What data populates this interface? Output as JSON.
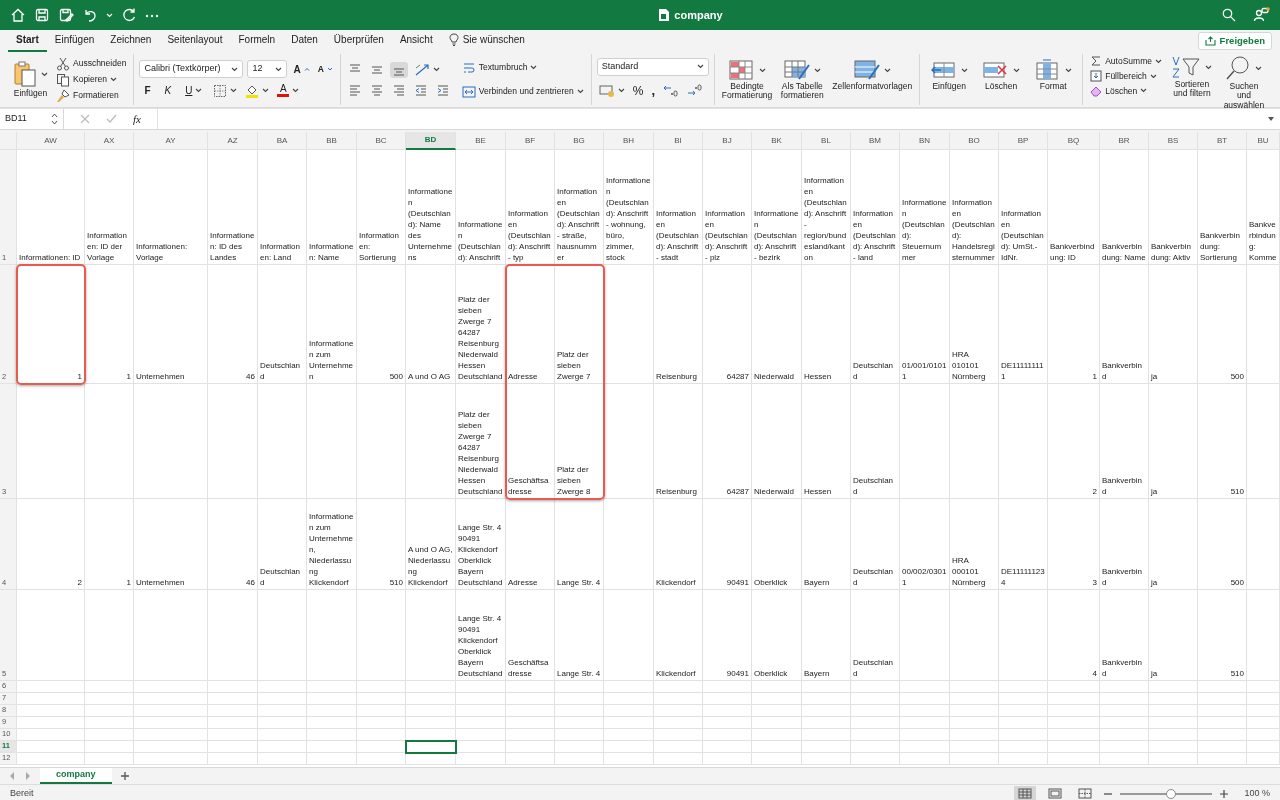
{
  "title_bar": {
    "title": "company"
  },
  "menu_tabs": [
    {
      "label": "Start",
      "selected": true
    },
    {
      "label": "Einfügen",
      "selected": false
    },
    {
      "label": "Zeichnen",
      "selected": false
    },
    {
      "label": "Seitenlayout",
      "selected": false
    },
    {
      "label": "Formeln",
      "selected": false
    },
    {
      "label": "Daten",
      "selected": false
    },
    {
      "label": "Überprüfen",
      "selected": false
    },
    {
      "label": "Ansicht",
      "selected": false
    }
  ],
  "tell_me": "Sie wünschen",
  "share_button": "Freigeben",
  "ribbon": {
    "clipboard": {
      "paste": "Einfügen",
      "items": [
        {
          "kind": "cut",
          "label": "Ausschneiden",
          "dropdown": false
        },
        {
          "kind": "copy",
          "label": "Kopieren",
          "dropdown": true
        },
        {
          "kind": "brush",
          "label": "Formatieren",
          "dropdown": false
        }
      ]
    },
    "font": {
      "name": "Calibri (Textkörper)",
      "size": "12",
      "grow": "A",
      "shrink": "A",
      "styles": [
        {
          "kind": "bold",
          "label": "F"
        },
        {
          "kind": "italic",
          "label": "K"
        },
        {
          "kind": "underline",
          "label": "U"
        }
      ],
      "font_color": "A"
    },
    "alignment": {
      "vertical": [
        {
          "kind": "top",
          "selected": false
        },
        {
          "kind": "middle",
          "selected": false
        },
        {
          "kind": "bottom",
          "selected": true
        }
      ],
      "wrap": "Textumbruch",
      "merge": "Verbinden und zentrieren"
    },
    "number": {
      "format": "Standard",
      "percent": "%",
      "comma": ","
    },
    "styles": [
      {
        "kind": "conditional",
        "label": "Bedingte Formatierung"
      },
      {
        "kind": "table",
        "label": "Als Tabelle formatieren"
      },
      {
        "kind": "cellstyle",
        "label": "Zellenformatvorlagen"
      }
    ],
    "cells": [
      {
        "kind": "insert",
        "label": "Einfügen"
      },
      {
        "kind": "delete",
        "label": "Löschen"
      },
      {
        "kind": "format",
        "label": "Format"
      }
    ],
    "editing": {
      "items": [
        {
          "kind": "sum",
          "label": "AutoSumme"
        },
        {
          "kind": "fill",
          "label": "Füllbereich"
        },
        {
          "kind": "clear",
          "label": "Löschen"
        }
      ],
      "large": [
        {
          "kind": "sort",
          "label": "Sortieren und filtern"
        },
        {
          "kind": "find",
          "label": "Suchen und auswählen"
        }
      ]
    }
  },
  "formula_bar": {
    "name_box": "BD11",
    "function_label": "fx"
  },
  "sheet": {
    "columns": [
      {
        "letter": "AW",
        "kind": "number",
        "selected": false
      },
      {
        "letter": "AX",
        "kind": "number",
        "selected": false
      },
      {
        "letter": "AY",
        "kind": "text",
        "selected": false
      },
      {
        "letter": "AZ",
        "kind": "number",
        "selected": false
      },
      {
        "letter": "BA",
        "kind": "text",
        "selected": false
      },
      {
        "letter": "BB",
        "kind": "text",
        "selected": false
      },
      {
        "letter": "BC",
        "kind": "number",
        "selected": false
      },
      {
        "letter": "BD",
        "kind": "text",
        "selected": true
      },
      {
        "letter": "BE",
        "kind": "text",
        "selected": false
      },
      {
        "letter": "BF",
        "kind": "text",
        "selected": false
      },
      {
        "letter": "BG",
        "kind": "text",
        "selected": false
      },
      {
        "letter": "BH",
        "kind": "text",
        "selected": false
      },
      {
        "letter": "BI",
        "kind": "text",
        "selected": false
      },
      {
        "letter": "BJ",
        "kind": "number",
        "selected": false
      },
      {
        "letter": "BK",
        "kind": "text",
        "selected": false
      },
      {
        "letter": "BL",
        "kind": "text",
        "selected": false
      },
      {
        "letter": "BM",
        "kind": "text",
        "selected": false
      },
      {
        "letter": "BN",
        "kind": "text",
        "selected": false
      },
      {
        "letter": "BO",
        "kind": "text",
        "selected": false
      },
      {
        "letter": "BP",
        "kind": "text",
        "selected": false
      },
      {
        "letter": "BQ",
        "kind": "number",
        "selected": false
      },
      {
        "letter": "BR",
        "kind": "text",
        "selected": false
      },
      {
        "letter": "BS",
        "kind": "text",
        "selected": false
      },
      {
        "letter": "BT",
        "kind": "number",
        "selected": false
      },
      {
        "letter": "BU",
        "kind": "text",
        "selected": false
      }
    ],
    "rows": [
      {
        "number": "1",
        "kind": "header",
        "selected": false,
        "cells": [
          "Informationen: ID",
          "Informationen: ID der Vorlage",
          "Informationen: Vorlage",
          "Informationen: ID des Landes",
          "Informationen: Land",
          "Informationen: Name",
          "Informationen: Sortierung",
          "Informationen (Deutschland): Name des Unternehmens",
          "Informationen (Deutschland): Anschrift",
          "Informationen (Deutschland): Anschrift - typ",
          "Informationen (Deutschland): Anschrift - straße, hausnummer",
          "Informationen (Deutschland): Anschrift - wohnung, büro, zimmer, stock",
          "Informationen (Deutschland): Anschrift - stadt",
          "Informationen (Deutschland): Anschrift - plz",
          "Informationen (Deutschland): Anschrift - bezirk",
          "Informationen (Deutschland): Anschrift - region/bundesland/kanton",
          "Informationen (Deutschland): Anschrift - land",
          "Informationen (Deutschland): Steuernummer",
          "Informationen (Deutschland): Handelsregisternummer",
          "Informationen (Deutschland): UmSt.-IdNr.",
          "Bankverbindung: ID",
          "Bankverbindung: Name",
          "Bankverbindung: Aktiv",
          "Bankverbindung: Sortierung",
          "Bankverbindung: Komme"
        ]
      },
      {
        "number": "2",
        "kind": "data",
        "selected": false,
        "cells": [
          {
            "text": "1",
            "highlight": true
          },
          "1",
          "Unternehmen",
          "46",
          "Deutschland",
          "Informationen zum Unternehmen",
          "500",
          "A und O AG",
          "Platz der sieben Zwerge 7 64287 Reisenburg Niederwald Hessen Deutschland",
          {
            "text": "Adresse",
            "highlight": true
          },
          {
            "text": "Platz der sieben Zwerge 7",
            "highlight": true
          },
          null,
          "Reisenburg",
          "64287",
          "Niederwald",
          "Hessen",
          "Deutschland",
          "01/001/01011",
          "HRA 010101 Nürnberg",
          "DE111111111",
          "1",
          "Bankverbind",
          "ja",
          "500",
          null
        ]
      },
      {
        "number": "3",
        "kind": "data",
        "selected": false,
        "cells": [
          null,
          null,
          null,
          null,
          null,
          null,
          null,
          null,
          "Platz der sieben Zwerge 7 64287 Reisenburg Niederwald Hessen Deutschland",
          {
            "text": "Geschäftsadresse",
            "highlight": true
          },
          {
            "text": "Platz der sieben Zwerge 8",
            "highlight": true
          },
          null,
          "Reisenburg",
          "64287",
          "Niederwald",
          "Hessen",
          "Deutschland",
          null,
          null,
          null,
          "2",
          "Bankverbind",
          "ja",
          "510",
          null
        ]
      },
      {
        "number": "4",
        "kind": "data",
        "selected": false,
        "cells": [
          "2",
          "1",
          "Unternehmen",
          "46",
          "Deutschland",
          "Informationen zum Unternehmen, Niederlassung Klickendorf",
          "510",
          "A und O AG, Niederlassung Klickendorf",
          "Lange Str. 4 90491 Klickendorf Oberklick Bayern Deutschland",
          "Adresse",
          "Lange Str. 4",
          null,
          "Klickendorf",
          "90491",
          "Oberklick",
          "Bayern",
          "Deutschland",
          "00/002/03011",
          "HRA 000101 Nürnberg",
          "DE111111234",
          "3",
          "Bankverbind",
          "ja",
          "500",
          null
        ]
      },
      {
        "number": "5",
        "kind": "data",
        "selected": false,
        "cells": [
          null,
          null,
          null,
          null,
          null,
          null,
          null,
          null,
          "Lange Str. 4 90491 Klickendorf Oberklick Bayern Deutschland",
          "Geschäftsadresse",
          "Lange Str. 4",
          null,
          "Klickendorf",
          "90491",
          "Oberklick",
          "Bayern",
          "Deutschland",
          null,
          null,
          null,
          "4",
          "Bankverbind",
          "ja",
          "510",
          null
        ]
      },
      {
        "number": "6",
        "kind": "data",
        "selected": false,
        "cells": []
      },
      {
        "number": "7",
        "kind": "data",
        "selected": false,
        "cells": []
      },
      {
        "number": "8",
        "kind": "data",
        "selected": false,
        "cells": []
      },
      {
        "number": "9",
        "kind": "data",
        "selected": false,
        "cells": []
      },
      {
        "number": "10",
        "kind": "data",
        "selected": false,
        "cells": []
      },
      {
        "number": "11",
        "kind": "data",
        "selected": true,
        "cells": []
      },
      {
        "number": "12",
        "kind": "data",
        "selected": false,
        "cells": []
      }
    ]
  },
  "sheet_tabs": [
    {
      "label": "company",
      "selected": true
    }
  ],
  "status_bar": {
    "status": "Bereit",
    "views": [
      {
        "kind": "normal",
        "selected": true
      },
      {
        "kind": "layout",
        "selected": false
      },
      {
        "kind": "pagebreak",
        "selected": false
      }
    ],
    "zoom": {
      "level": 0.55,
      "label": "100 %"
    }
  }
}
